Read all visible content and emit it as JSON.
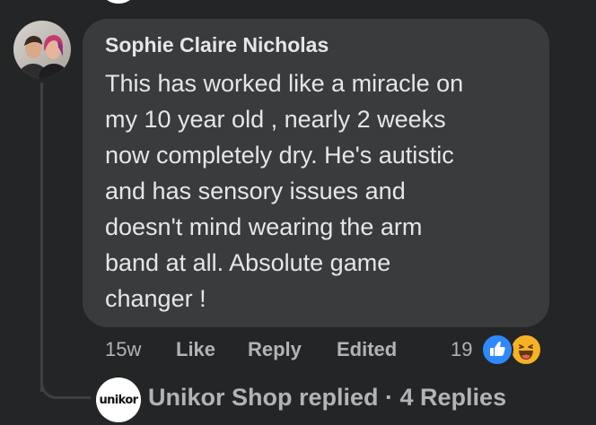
{
  "comment": {
    "author": "Sophie Claire Nicholas",
    "lines": [
      "This has worked like a miracle on",
      "my 10 year old , nearly 2 weeks",
      "now completely dry. He's autistic",
      "and has sensory issues and",
      "doesn't mind wearing the arm",
      "band at all. Absolute game",
      "changer !"
    ],
    "avatar_icon": "user-avatar-photo"
  },
  "actions": {
    "time": "15w",
    "like": "Like",
    "reply": "Reply",
    "edited": "Edited"
  },
  "reactions": {
    "count": "19",
    "types": [
      "like-icon",
      "haha-icon"
    ],
    "like_color": "#2e89ff",
    "haha_color": "#f7b125"
  },
  "reply_summary": {
    "logo_text": "unikor",
    "text": "Unikor Shop replied · 4 Replies"
  },
  "colors": {
    "background": "#242526",
    "bubble": "#3a3b3c",
    "primary_text": "#e4e6eb",
    "secondary_text": "#b0b3b8"
  }
}
